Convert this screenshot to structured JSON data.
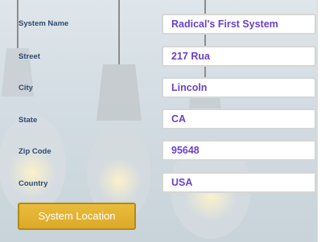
{
  "form": {
    "fields": [
      {
        "label": "System Name",
        "value": "Radical's First System"
      },
      {
        "label": "Street",
        "value": "217 Rua"
      },
      {
        "label": "City",
        "value": "Lincoln"
      },
      {
        "label": "State",
        "value": "CA"
      },
      {
        "label": "Zip Code",
        "value": "95648"
      },
      {
        "label": "Country",
        "value": "USA"
      }
    ],
    "location_button_label": "System Location"
  },
  "colors": {
    "field_text": "#6a41c9",
    "label_text": "#2f4a6e",
    "button_fill": "#dca92a"
  },
  "background": {
    "icon": "hanging-light-bulbs-icon"
  }
}
